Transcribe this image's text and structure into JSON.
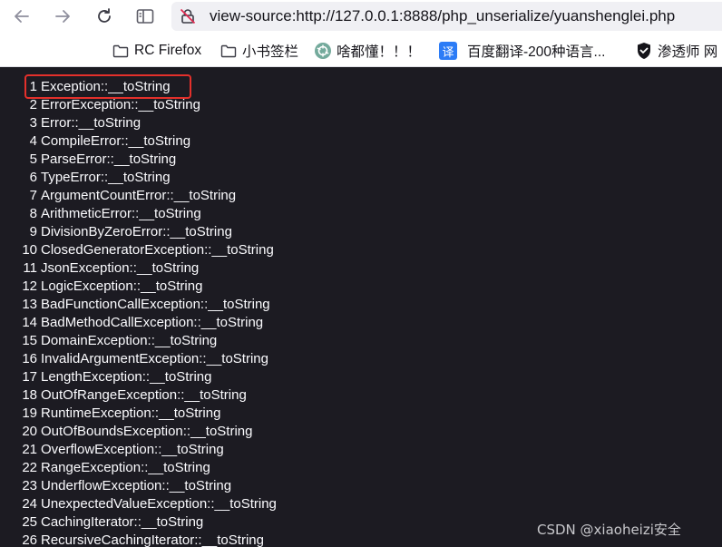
{
  "browser": {
    "url": "view-source:http://127.0.0.1:8888/php_unserialize/yuanshenglei.php",
    "icons": [
      "back-arrow-icon",
      "forward-arrow-icon",
      "reload-icon",
      "reader-view-icon",
      "insecure-lock-icon"
    ]
  },
  "bookmarks": [
    {
      "label": "RC Firefox",
      "icon": "folder-icon"
    },
    {
      "label": "小书签栏",
      "icon": "folder-icon"
    },
    {
      "label": "啥都懂！！！",
      "icon": "chatgpt-icon"
    },
    {
      "label": "百度翻译-200种语言...",
      "icon": "translate-icon"
    },
    {
      "label": "渗透师 网",
      "icon": "shield-icon"
    }
  ],
  "source_lines": [
    {
      "num": "1",
      "text": "Exception::__toString"
    },
    {
      "num": "2",
      "text": "ErrorException::__toString"
    },
    {
      "num": "3",
      "text": "Error::__toString"
    },
    {
      "num": "4",
      "text": "CompileError::__toString"
    },
    {
      "num": "5",
      "text": "ParseError::__toString"
    },
    {
      "num": "6",
      "text": "TypeError::__toString"
    },
    {
      "num": "7",
      "text": "ArgumentCountError::__toString"
    },
    {
      "num": "8",
      "text": "ArithmeticError::__toString"
    },
    {
      "num": "9",
      "text": "DivisionByZeroError::__toString"
    },
    {
      "num": "10",
      "text": "ClosedGeneratorException::__toString"
    },
    {
      "num": "11",
      "text": "JsonException::__toString"
    },
    {
      "num": "12",
      "text": "LogicException::__toString"
    },
    {
      "num": "13",
      "text": "BadFunctionCallException::__toString"
    },
    {
      "num": "14",
      "text": "BadMethodCallException::__toString"
    },
    {
      "num": "15",
      "text": "DomainException::__toString"
    },
    {
      "num": "16",
      "text": "InvalidArgumentException::__toString"
    },
    {
      "num": "17",
      "text": "LengthException::__toString"
    },
    {
      "num": "18",
      "text": "OutOfRangeException::__toString"
    },
    {
      "num": "19",
      "text": "RuntimeException::__toString"
    },
    {
      "num": "20",
      "text": "OutOfBoundsException::__toString"
    },
    {
      "num": "21",
      "text": "OverflowException::__toString"
    },
    {
      "num": "22",
      "text": "RangeException::__toString"
    },
    {
      "num": "23",
      "text": "UnderflowException::__toString"
    },
    {
      "num": "24",
      "text": "UnexpectedValueException::__toString"
    },
    {
      "num": "25",
      "text": "CachingIterator::__toString"
    },
    {
      "num": "26",
      "text": "RecursiveCachingIterator::__toString"
    }
  ],
  "watermark": "CSDN @xiaoheizi安全",
  "colors": {
    "source_background": "#1c1b22",
    "source_text": "#fbfbfe",
    "highlight_border": "#e4302b",
    "toolbar_background": "#ffffff",
    "urlbar_background": "#f0f0f4"
  }
}
